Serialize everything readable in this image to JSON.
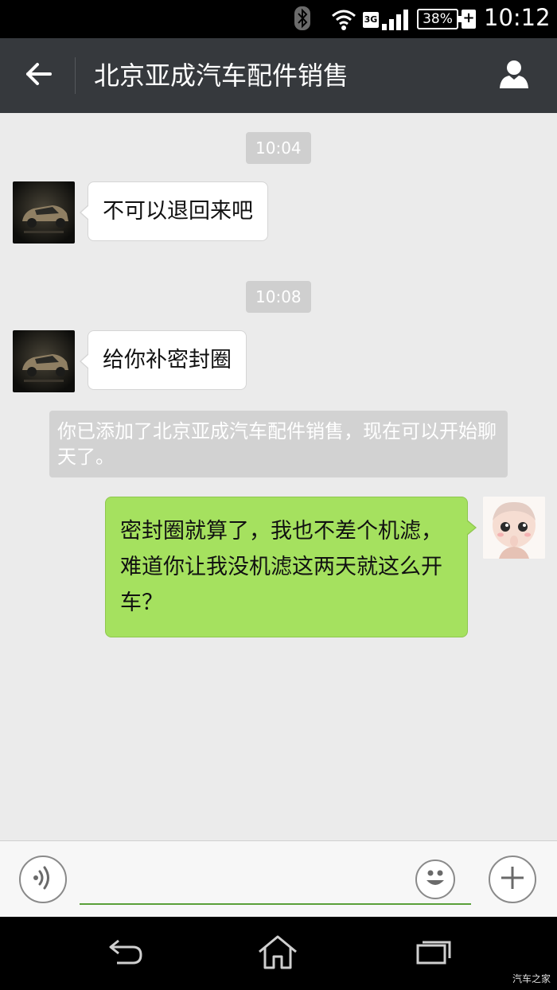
{
  "status_bar": {
    "network": "3G",
    "battery": "38%",
    "charging": "+",
    "time": "10:12",
    "icons": [
      "bluetooth-icon",
      "wifi-icon",
      "signal-icon"
    ]
  },
  "header": {
    "title": "北京亚成汽车配件销售",
    "back_icon": "arrow-left-icon",
    "profile_icon": "user-icon"
  },
  "chat": {
    "messages": [
      {
        "type": "time",
        "text": "10:04"
      },
      {
        "type": "incoming",
        "text": "不可以退回来吧"
      },
      {
        "type": "time",
        "text": "10:08"
      },
      {
        "type": "incoming",
        "text": "给你补密封圈"
      },
      {
        "type": "system",
        "text": "你已添加了北京亚成汽车配件销售，现在可以开始聊天了。"
      },
      {
        "type": "outgoing",
        "text": "密封圈就算了，我也不差个机滤，难道你让我没机滤这两天就这么开车？"
      }
    ]
  },
  "input_bar": {
    "placeholder": "",
    "value": "",
    "voice_icon": "voice-icon",
    "emoji_icon": "emoji-icon",
    "plus_icon": "plus-icon"
  },
  "nav_bar": {
    "icons": [
      "back-icon",
      "home-icon",
      "recents-icon"
    ],
    "watermark": "汽车之家"
  },
  "colors": {
    "chat_background": "#ebebeb",
    "header_background": "#36393d",
    "outgoing_bubble": "#a5e15f",
    "incoming_bubble": "#ffffff",
    "accent": "#5aa03a"
  }
}
